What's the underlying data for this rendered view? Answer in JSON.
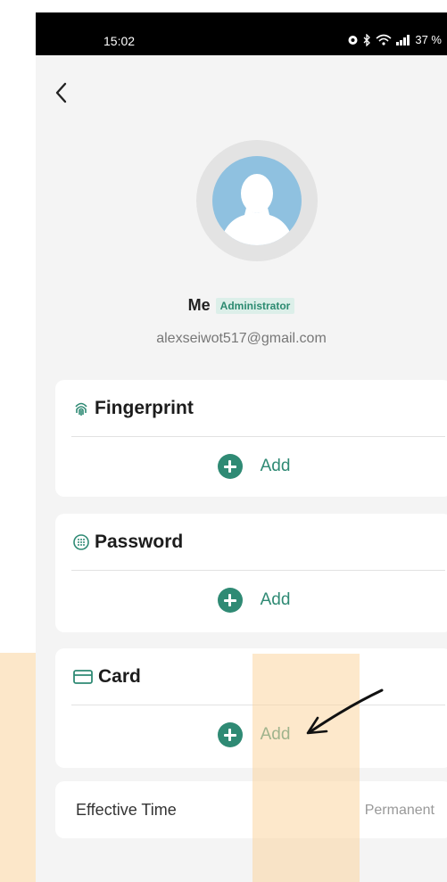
{
  "status_bar": {
    "time": "15:02",
    "battery": "37 %"
  },
  "icons": {
    "back": "back-chevron-icon",
    "avatar": "default-avatar-icon",
    "fingerprint": "fingerprint-icon",
    "password": "keypad-icon",
    "card": "card-icon",
    "add": "plus-circle-icon"
  },
  "profile": {
    "name": "Me",
    "role": "Administrator",
    "email": "alexseiwot517@gmail.com"
  },
  "sections": [
    {
      "title": "Fingerprint",
      "add_label": "Add"
    },
    {
      "title": "Password",
      "add_label": "Add"
    },
    {
      "title": "Card",
      "add_label": "Add"
    }
  ],
  "effective_time": {
    "label": "Effective Time",
    "value": "Permanent"
  },
  "colors": {
    "accent": "#2f8a74",
    "background": "#f4f4f4",
    "watermark": "#fbe3bf"
  }
}
